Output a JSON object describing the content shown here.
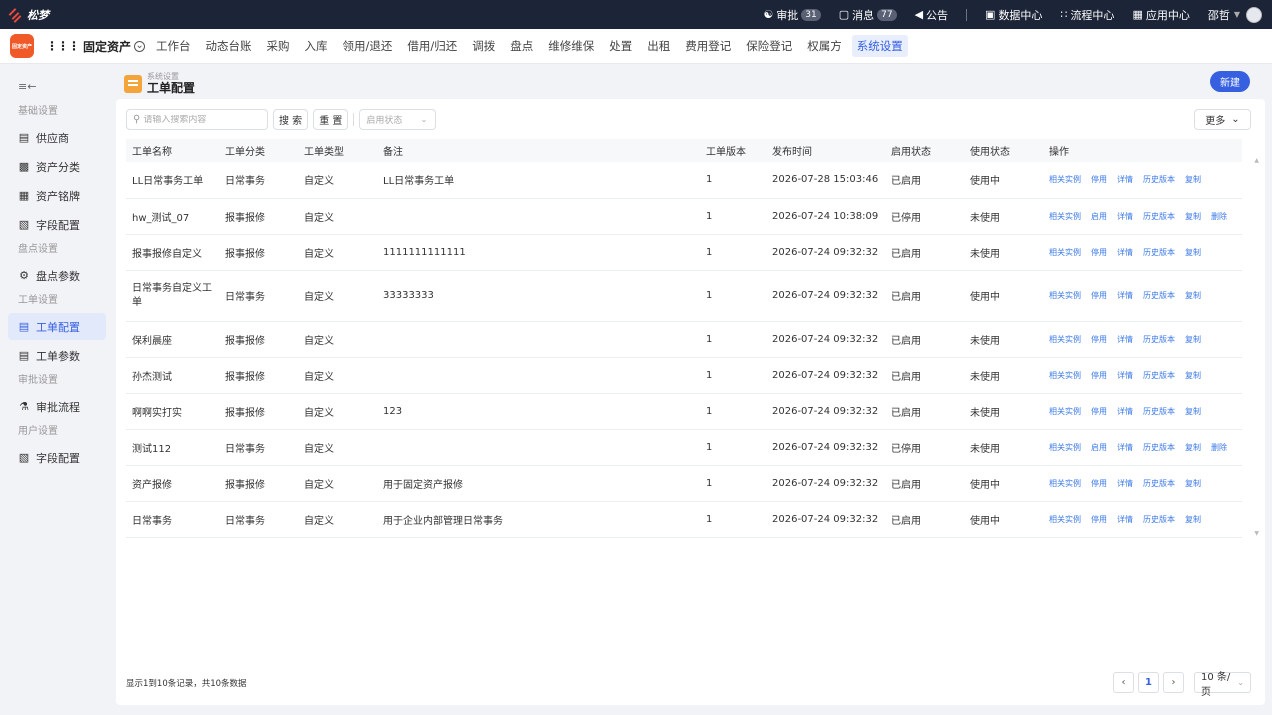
{
  "topbar": {
    "brand": "松梦",
    "approval_label": "审批",
    "approval_count": "31",
    "message_label": "消息",
    "message_count": "77",
    "notice_label": "公告",
    "data_center": "数据中心",
    "flow_center": "流程中心",
    "app_center": "应用中心",
    "user_name": "邵哲"
  },
  "modnav": {
    "app_icon_text": "固定资产",
    "app_title": "固定资产",
    "tabs": [
      "工作台",
      "动态台账",
      "采购",
      "入库",
      "领用/退还",
      "借用/归还",
      "调拨",
      "盘点",
      "维修维保",
      "处置",
      "出租",
      "费用登记",
      "保险登记",
      "权属方",
      "系统设置"
    ]
  },
  "sidebar": {
    "groups": {
      "basic": "基础设置",
      "inventory": "盘点设置",
      "workorder": "工单设置",
      "approval": "审批设置",
      "user": "用户设置"
    },
    "items": {
      "supplier": "供应商",
      "asset_category": "资产分类",
      "asset_brand": "资产铭牌",
      "field_config": "字段配置",
      "inventory_params": "盘点参数",
      "workorder_config": "工单配置",
      "workorder_params": "工单参数",
      "approval_flow": "审批流程",
      "user_field_config": "字段配置"
    }
  },
  "page": {
    "breadcrumb": "系统设置",
    "title": "工单配置",
    "new_button": "新建"
  },
  "toolbar": {
    "search_placeholder": "请输入搜索内容",
    "search_button": "搜 索",
    "reset_button": "重 置",
    "status_placeholder": "启用状态",
    "more_button": "更多"
  },
  "table": {
    "headers": [
      "工单名称",
      "工单分类",
      "工单类型",
      "备注",
      "工单版本",
      "发布时间",
      "启用状态",
      "使用状态",
      "操作"
    ],
    "rows": [
      {
        "name": "LL日常事务工单",
        "category": "日常事务",
        "type": "自定义",
        "remark": "LL日常事务工单",
        "version": "1",
        "time": "2026-07-28 15:03:46",
        "enabled": "已启用",
        "usage": "使用中",
        "ops": [
          "相关实例",
          "停用",
          "详情",
          "历史版本",
          "复制"
        ]
      },
      {
        "name": "hw_测试_07",
        "category": "报事报修",
        "type": "自定义",
        "remark": "",
        "version": "1",
        "time": "2026-07-24 10:38:09",
        "enabled": "已停用",
        "usage": "未使用",
        "ops": [
          "相关实例",
          "启用",
          "详情",
          "历史版本",
          "复制",
          "删除"
        ]
      },
      {
        "name": "报事报修自定义",
        "category": "报事报修",
        "type": "自定义",
        "remark": "1111111111111",
        "version": "1",
        "time": "2026-07-24 09:32:32",
        "enabled": "已启用",
        "usage": "未使用",
        "ops": [
          "相关实例",
          "停用",
          "详情",
          "历史版本",
          "复制"
        ]
      },
      {
        "name": "日常事务自定义工单",
        "category": "日常事务",
        "type": "自定义",
        "remark": "33333333",
        "version": "1",
        "time": "2026-07-24 09:32:32",
        "enabled": "已启用",
        "usage": "使用中",
        "ops": [
          "相关实例",
          "停用",
          "详情",
          "历史版本",
          "复制"
        ]
      },
      {
        "name": "保利晨座",
        "category": "报事报修",
        "type": "自定义",
        "remark": "",
        "version": "1",
        "time": "2026-07-24 09:32:32",
        "enabled": "已启用",
        "usage": "未使用",
        "ops": [
          "相关实例",
          "停用",
          "详情",
          "历史版本",
          "复制"
        ]
      },
      {
        "name": "孙杰测试",
        "category": "报事报修",
        "type": "自定义",
        "remark": "",
        "version": "1",
        "time": "2026-07-24 09:32:32",
        "enabled": "已启用",
        "usage": "未使用",
        "ops": [
          "相关实例",
          "停用",
          "详情",
          "历史版本",
          "复制"
        ]
      },
      {
        "name": "啊啊实打实",
        "category": "报事报修",
        "type": "自定义",
        "remark": "123",
        "version": "1",
        "time": "2026-07-24 09:32:32",
        "enabled": "已启用",
        "usage": "未使用",
        "ops": [
          "相关实例",
          "停用",
          "详情",
          "历史版本",
          "复制"
        ]
      },
      {
        "name": "测试112",
        "category": "日常事务",
        "type": "自定义",
        "remark": "",
        "version": "1",
        "time": "2026-07-24 09:32:32",
        "enabled": "已停用",
        "usage": "未使用",
        "ops": [
          "相关实例",
          "启用",
          "详情",
          "历史版本",
          "复制",
          "删除"
        ]
      },
      {
        "name": "资产报修",
        "category": "报事报修",
        "type": "自定义",
        "remark": "用于固定资产报修",
        "version": "1",
        "time": "2026-07-24 09:32:32",
        "enabled": "已启用",
        "usage": "使用中",
        "ops": [
          "相关实例",
          "停用",
          "详情",
          "历史版本",
          "复制"
        ]
      },
      {
        "name": "日常事务",
        "category": "日常事务",
        "type": "自定义",
        "remark": "用于企业内部管理日常事务",
        "version": "1",
        "time": "2026-07-24 09:32:32",
        "enabled": "已启用",
        "usage": "使用中",
        "ops": [
          "相关实例",
          "停用",
          "详情",
          "历史版本",
          "复制"
        ]
      }
    ]
  },
  "footer": {
    "summary": "显示1到10条记录，共10条数据",
    "current_page": "1",
    "page_size": "10 条/页"
  },
  "colors": {
    "topbar_bg": "#1c2437",
    "accent": "#3660e0",
    "link": "#3a78e6",
    "app_icon": "#f05a28"
  }
}
